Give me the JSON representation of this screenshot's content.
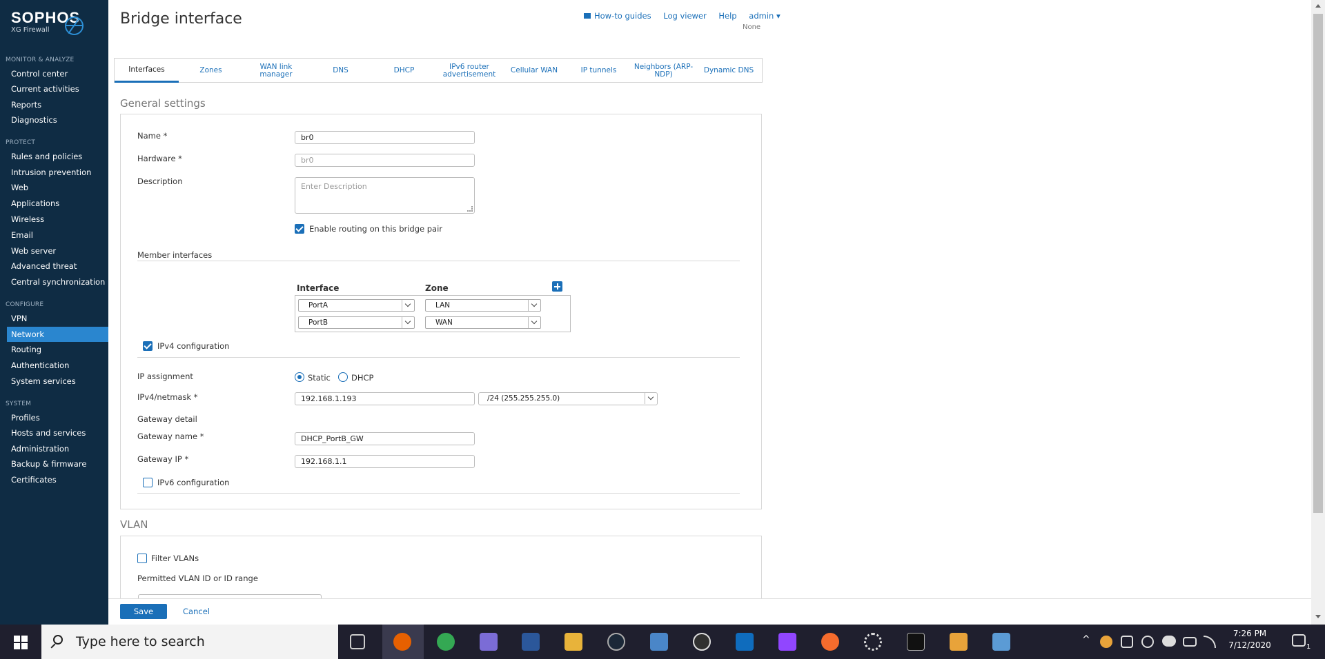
{
  "brand": {
    "name": "SOPHOS",
    "product": "XG Firewall"
  },
  "sidebar": {
    "sections": [
      {
        "label": "MONITOR & ANALYZE",
        "items": [
          "Control center",
          "Current activities",
          "Reports",
          "Diagnostics"
        ]
      },
      {
        "label": "PROTECT",
        "items": [
          "Rules and policies",
          "Intrusion prevention",
          "Web",
          "Applications",
          "Wireless",
          "Email",
          "Web server",
          "Advanced threat",
          "Central synchronization"
        ]
      },
      {
        "label": "CONFIGURE",
        "items": [
          "VPN",
          "Network",
          "Routing",
          "Authentication",
          "System services"
        ]
      },
      {
        "label": "SYSTEM",
        "items": [
          "Profiles",
          "Hosts and services",
          "Administration",
          "Backup & firmware",
          "Certificates"
        ]
      }
    ],
    "active": "Network"
  },
  "header": {
    "title": "Bridge interface",
    "links": [
      "How-to guides",
      "Log viewer",
      "Help"
    ],
    "user": "admin ▾",
    "user_sub": "None"
  },
  "tabs": [
    "Interfaces",
    "Zones",
    "WAN link manager",
    "DNS",
    "DHCP",
    "IPv6 router advertisement",
    "Cellular WAN",
    "IP tunnels",
    "Neighbors (ARP-NDP)",
    "Dynamic DNS"
  ],
  "general": {
    "heading": "General settings",
    "name_label": "Name *",
    "name_value": "br0",
    "hardware_label": "Hardware *",
    "hardware_value": "br0",
    "description_label": "Description",
    "description_placeholder": "Enter  Description",
    "routing_label": "Enable routing on this bridge pair",
    "routing_checked": true
  },
  "members": {
    "heading": "Member interfaces",
    "col_interface": "Interface",
    "col_zone": "Zone",
    "rows": [
      {
        "interface": "PortA",
        "zone": "LAN"
      },
      {
        "interface": "PortB",
        "zone": "WAN"
      }
    ]
  },
  "ipv4": {
    "label": "IPv4 configuration",
    "checked": true,
    "ip_assignment_label": "IP assignment",
    "static_label": "Static",
    "dhcp_label": "DHCP",
    "selected": "Static",
    "netmask_label": "IPv4/netmask *",
    "ip_value": "192.168.1.193",
    "netmask_value": "/24 (255.255.255.0)",
    "gateway_detail_label": "Gateway detail",
    "gateway_name_label": "Gateway name  *",
    "gateway_name_value": "DHCP_PortB_GW",
    "gateway_ip_label": "Gateway IP  *",
    "gateway_ip_value": "192.168.1.1"
  },
  "ipv6": {
    "label": "IPv6 configuration",
    "checked": false
  },
  "vlan": {
    "heading": "VLAN",
    "filter_label": "Filter VLANs",
    "filter_checked": false,
    "permitted_label": "Permitted VLAN ID or ID range"
  },
  "footer": {
    "save": "Save",
    "cancel": "Cancel"
  },
  "taskbar": {
    "search_placeholder": "Type here to search",
    "time": "7:26 PM",
    "date": "7/12/2020",
    "notification_count": "1"
  },
  "colors": {
    "sidebar": "#0f2c44",
    "accent": "#1a6fb8",
    "active_nav": "#2a86cf"
  }
}
